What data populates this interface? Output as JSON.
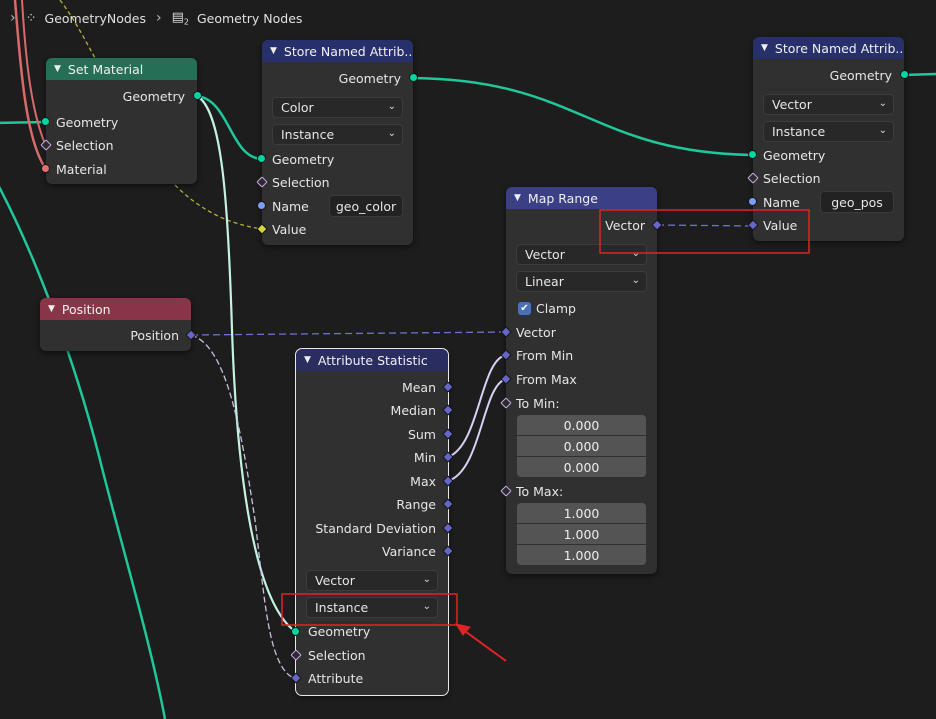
{
  "breadcrumb": {
    "item1": "GeometryNodes",
    "item2": "Geometry Nodes",
    "item2_badge": "2"
  },
  "set_material": {
    "title": "Set Material",
    "out_geometry": "Geometry",
    "in_geometry": "Geometry",
    "in_selection": "Selection",
    "in_material": "Material"
  },
  "store_named_1": {
    "title": "Store Named Attrib...",
    "out_geometry": "Geometry",
    "data_type": "Color",
    "domain": "Instance",
    "in_geometry": "Geometry",
    "in_selection": "Selection",
    "in_name": "Name",
    "name_value": "geo_color",
    "in_value": "Value"
  },
  "store_named_2": {
    "title": "Store Named Attrib...",
    "out_geometry": "Geometry",
    "data_type": "Vector",
    "domain": "Instance",
    "in_geometry": "Geometry",
    "in_selection": "Selection",
    "in_name": "Name",
    "name_value": "geo_pos",
    "in_value": "Value"
  },
  "map_range": {
    "title": "Map Range",
    "out_vector": "Vector",
    "data_type": "Vector",
    "interpolation": "Linear",
    "clamp_label": "Clamp",
    "clamp_checked": true,
    "in_vector": "Vector",
    "in_from_min": "From Min",
    "in_from_max": "From Max",
    "to_min_label": "To Min:",
    "to_min": [
      "0.000",
      "0.000",
      "0.000"
    ],
    "to_max_label": "To Max:",
    "to_max": [
      "1.000",
      "1.000",
      "1.000"
    ]
  },
  "position": {
    "title": "Position",
    "out_position": "Position"
  },
  "attribute_statistic": {
    "title": "Attribute Statistic",
    "outputs": [
      "Mean",
      "Median",
      "Sum",
      "Min",
      "Max",
      "Range",
      "Standard Deviation",
      "Variance"
    ],
    "data_type": "Vector",
    "domain": "Instance",
    "in_geometry": "Geometry",
    "in_selection": "Selection",
    "in_attribute": "Attribute"
  },
  "colors": {
    "geometry_socket": "#00d6a3",
    "vector_socket": "#6666c8",
    "highlight_box": "#e02424",
    "annotation_arrow": "#e02424"
  }
}
